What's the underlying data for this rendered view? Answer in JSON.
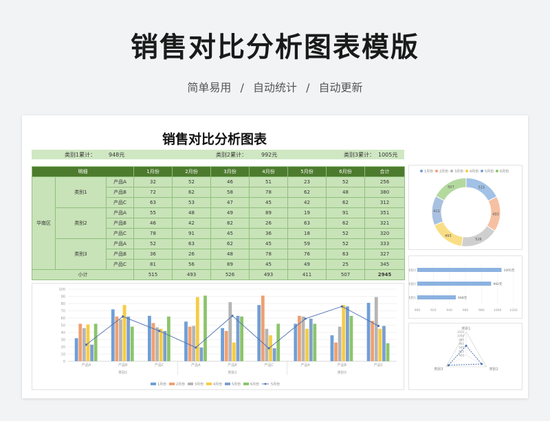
{
  "page": {
    "title": "销售对比分析图表模版",
    "subtitle": "简单易用  /  自动统计  /  自动更新"
  },
  "sheet": {
    "title": "销售对比分析图表",
    "summary": [
      {
        "label": "类别1累计：",
        "value": "948元"
      },
      {
        "label": "类别2累计：",
        "value": "992元"
      },
      {
        "label": "类别3累计：",
        "value": "1005元"
      }
    ]
  },
  "table": {
    "headers": [
      "明细",
      "1月份",
      "2月份",
      "3月份",
      "4月份",
      "5月份",
      "6月份",
      "合计"
    ],
    "region": "华南区",
    "categories": [
      "类别1",
      "类别2",
      "类别3"
    ],
    "products": [
      "产品A",
      "产品B",
      "产品C"
    ],
    "rows": [
      {
        "months": [
          "32",
          "52",
          "46",
          "51",
          "23",
          "52"
        ],
        "total": "256"
      },
      {
        "months": [
          "72",
          "62",
          "58",
          "78",
          "62",
          "48"
        ],
        "total": "380"
      },
      {
        "months": [
          "63",
          "53",
          "47",
          "45",
          "42",
          "62"
        ],
        "total": "312"
      },
      {
        "months": [
          "55",
          "48",
          "49",
          "89",
          "19",
          "91"
        ],
        "total": "351"
      },
      {
        "months": [
          "46",
          "42",
          "82",
          "26",
          "63",
          "62"
        ],
        "total": "321"
      },
      {
        "months": [
          "78",
          "91",
          "45",
          "36",
          "18",
          "52"
        ],
        "total": "320"
      },
      {
        "months": [
          "52",
          "63",
          "62",
          "45",
          "59",
          "52"
        ],
        "total": "333"
      },
      {
        "months": [
          "36",
          "26",
          "48",
          "78",
          "76",
          "63"
        ],
        "total": "327"
      },
      {
        "months": [
          "81",
          "56",
          "89",
          "45",
          "49",
          "25"
        ],
        "total": "345"
      }
    ],
    "subtotal_label": "小计",
    "subtotal": [
      "515",
      "493",
      "526",
      "493",
      "411",
      "507"
    ],
    "grand_total": "2945"
  },
  "colors": {
    "m1": "#6f9fd8",
    "m2": "#f0a070",
    "m3": "#b5b5b5",
    "m4": "#f7cc45",
    "m5": "#7b9fcf",
    "m6": "#8cc56c",
    "line": "#4a6fb0",
    "header": "#4d7b2e",
    "cell": "#c8e3b8"
  },
  "chart_data": [
    {
      "type": "bar",
      "categories": [
        "产品A",
        "产品B",
        "产品C",
        "产品A",
        "产品B",
        "产品C",
        "产品A",
        "产品B",
        "产品C"
      ],
      "groups": [
        "类别1",
        "类别2",
        "类别3"
      ],
      "ylim": [
        0,
        100
      ],
      "yticks": [
        "0",
        "10",
        "20",
        "30",
        "40",
        "50",
        "60",
        "70",
        "80",
        "90",
        "100"
      ],
      "series": [
        {
          "name": "1月份",
          "values": [
            32,
            72,
            63,
            55,
            46,
            78,
            52,
            36,
            81
          ]
        },
        {
          "name": "2月份",
          "values": [
            52,
            62,
            53,
            48,
            42,
            91,
            63,
            26,
            56
          ]
        },
        {
          "name": "3月份",
          "values": [
            46,
            58,
            47,
            49,
            82,
            45,
            62,
            48,
            89
          ]
        },
        {
          "name": "4月份",
          "values": [
            51,
            78,
            45,
            89,
            26,
            36,
            45,
            78,
            45
          ]
        },
        {
          "name": "5月份",
          "values": [
            23,
            62,
            42,
            19,
            63,
            18,
            59,
            76,
            49
          ]
        },
        {
          "name": "6月份",
          "values": [
            52,
            48,
            62,
            91,
            62,
            52,
            52,
            63,
            25
          ]
        }
      ],
      "line_series": {
        "name": "5月份",
        "values": [
          23,
          62,
          42,
          19,
          63,
          18,
          59,
          76,
          49
        ]
      },
      "legend": "bottom",
      "grid": true
    },
    {
      "type": "pie",
      "subtype": "donut",
      "labels": [
        "1月份",
        "2月份",
        "3月份",
        "4月份",
        "5月份",
        "6月份"
      ],
      "values": [
        515,
        493,
        526,
        493,
        411,
        507
      ],
      "legend": "top"
    },
    {
      "type": "bar",
      "orientation": "horizontal",
      "categories": [
        "类别1",
        "类别2",
        "类别3"
      ],
      "values": [
        948,
        992,
        1005
      ],
      "value_labels": [
        "948元",
        "992元",
        "1005元"
      ],
      "xlim": [
        900,
        1020
      ],
      "xticks": [
        "900",
        "920",
        "940",
        "960",
        "980",
        "1000",
        "1020"
      ]
    },
    {
      "type": "radar",
      "categories": [
        "类别1",
        "类别2",
        "类别3"
      ],
      "values": [
        948,
        992,
        1005
      ],
      "rlim": [
        900,
        1020
      ],
      "rticks": [
        "900",
        "920",
        "940",
        "960",
        "980",
        "1000",
        "1020"
      ]
    }
  ]
}
